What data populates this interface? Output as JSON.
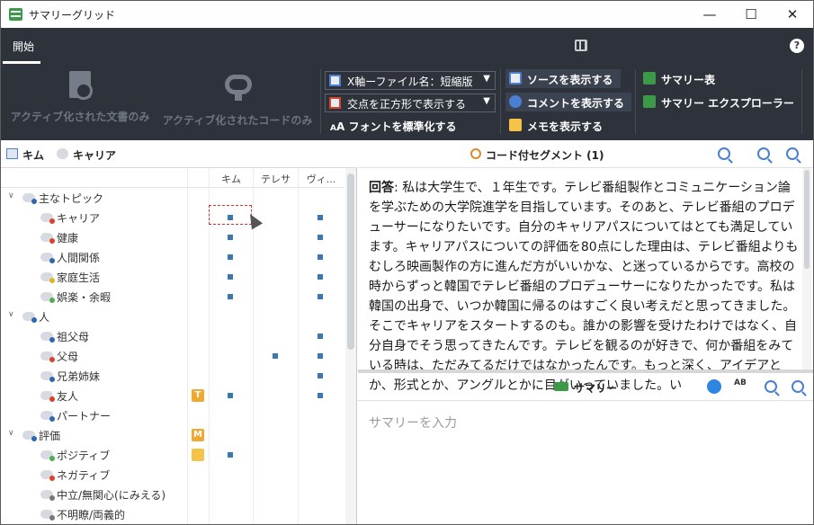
{
  "window": {
    "title": "サマリーグリッド",
    "minimize": "—",
    "maximize": "☐",
    "close": "✕"
  },
  "ribbon": {
    "tab_start": "開始",
    "btn_active_docs": "アクティブ化された文書のみ",
    "btn_active_codes": "アクティブ化されたコードのみ",
    "dd_xaxis": "X軸ーファイル名：短縮版",
    "dd_intersect": "交点を正方形で表示する",
    "font_normalize": "フォントを標準化する",
    "show_source": "ソースを表示する",
    "show_comment": "コメントを表示する",
    "show_memo": "メモを表示する",
    "summary_table": "サマリー表",
    "summary_explorer": "サマリー エクスプローラー",
    "help": "?"
  },
  "left": {
    "header_items": [
      "キム",
      "キャリア"
    ],
    "columns": [
      "キム",
      "テレサ",
      "ヴィ..."
    ],
    "rows": [
      {
        "label": "主なトピック",
        "level": 0,
        "dot": "#2f66b3",
        "marks": [
          false,
          false,
          false
        ],
        "badge": ""
      },
      {
        "label": "キャリア",
        "level": 1,
        "dot": "#d9432e",
        "marks": [
          true,
          false,
          true
        ],
        "badge": ""
      },
      {
        "label": "健康",
        "level": 1,
        "dot": "#d9432e",
        "marks": [
          true,
          false,
          true
        ],
        "badge": ""
      },
      {
        "label": "人間関係",
        "level": 1,
        "dot": "#2f66b3",
        "marks": [
          true,
          false,
          true
        ],
        "badge": ""
      },
      {
        "label": "家庭生活",
        "level": 1,
        "dot": "#e4b320",
        "marks": [
          true,
          false,
          true
        ],
        "badge": ""
      },
      {
        "label": "娯楽・余暇",
        "level": 1,
        "dot": "#4caf50",
        "marks": [
          true,
          false,
          true
        ],
        "badge": ""
      },
      {
        "label": "人",
        "level": 0,
        "dot": "#2f66b3",
        "marks": [
          false,
          false,
          false
        ],
        "badge": ""
      },
      {
        "label": "祖父母",
        "level": 1,
        "dot": "#2f66b3",
        "marks": [
          false,
          false,
          true
        ],
        "badge": ""
      },
      {
        "label": "父母",
        "level": 1,
        "dot": "#d9432e",
        "marks": [
          false,
          true,
          true
        ],
        "badge": ""
      },
      {
        "label": "兄弟姉妹",
        "level": 1,
        "dot": "#2f66b3",
        "marks": [
          false,
          false,
          true
        ],
        "badge": ""
      },
      {
        "label": "友人",
        "level": 1,
        "dot": "#d9432e",
        "marks": [
          true,
          false,
          true
        ],
        "badge": "T"
      },
      {
        "label": "パートナー",
        "level": 1,
        "dot": "#2f66b3",
        "marks": [
          false,
          false,
          false
        ],
        "badge": ""
      },
      {
        "label": "評価",
        "level": 0,
        "dot": "#2f66b3",
        "marks": [
          false,
          false,
          false
        ],
        "badge": "M"
      },
      {
        "label": "ポジティブ",
        "level": 1,
        "dot": "#4caf50",
        "marks": [
          true,
          false,
          false
        ],
        "badge": "note"
      },
      {
        "label": "ネガティブ",
        "level": 1,
        "dot": "#d9432e",
        "marks": [
          false,
          false,
          false
        ],
        "badge": ""
      },
      {
        "label": "中立/無関心(にみえる)",
        "level": 1,
        "dot": "#777777",
        "marks": [
          false,
          false,
          false
        ],
        "badge": ""
      },
      {
        "label": "不明瞭/両義的",
        "level": 1,
        "dot": "#777777",
        "marks": [
          false,
          false,
          false
        ],
        "badge": ""
      }
    ]
  },
  "right": {
    "segment_title": "コード付セグメント (1)",
    "answer_label": "回答",
    "segment_text": ": 私は大学生で、１年生です。テレビ番組製作とコミュニケーション論を学ぶための大学院進学を目指しています。そのあと、テレビ番組のプロデューサーになりたいです。自分のキャリアパスについてはとても満足しています。キャリアパスについての評価を80点にした理由は、テレビ番組よりもむしろ映画製作の方に進んだ方がいいかな、と迷っているからです。高校の時からずっと韓国でテレビ番組のプロデューサーになりたかったです。私は韓国の出身で、いつか韓国に帰るのはすごく良い考えだと思ってきました。そこでキャリアをスタートするのも。誰かの影響を受けたわけではなく、自分自身でそう思ってきたんです。テレビを観るのが好きで、何か番組をみている時は、ただみてるだけではなかったんです。もっと深く、アイデアとか、形式とか、アングルとかに目がいっていました。い",
    "summary_title": "サマリー",
    "summary_placeholder": "サマリーを入力"
  }
}
